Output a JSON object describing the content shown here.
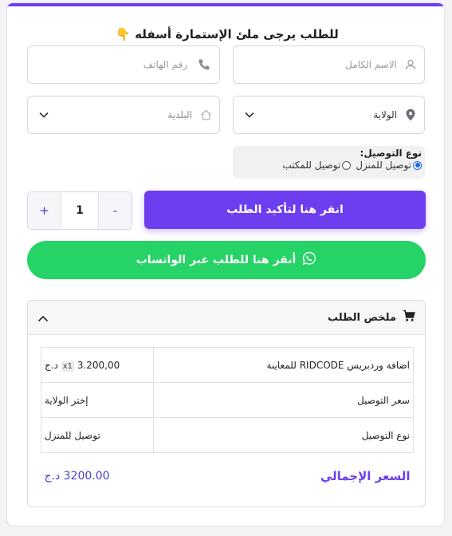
{
  "colors": {
    "accent": "#6c3ef0",
    "whatsapp": "#25d366"
  },
  "form": {
    "title": "للطلب يرجى ملئ الإستمارة أسفله",
    "title_emoji": "👇",
    "full_name_placeholder": "الاسم الكامل",
    "phone_placeholder": "رقم الهاتف",
    "state_select": "الولاية",
    "municipality_select": "البلدية",
    "delivery_type_label": "نوع التوصيل:",
    "delivery_options": [
      {
        "label": "توصيل للمنزل",
        "checked": true
      },
      {
        "label": "توصيل للمكتب",
        "checked": false
      }
    ],
    "quantity": "1",
    "minus_label": "-",
    "plus_label": "+",
    "confirm_button": "انقر هنا لتأكيد الطلب",
    "whatsapp_button": "أنقر هنا للطلب عبر الواتساب"
  },
  "summary": {
    "title": "ملخص الطلب",
    "rows": [
      {
        "label": "اضافة وردبريس RIDCODE للمعاينة",
        "qty": "x1",
        "value": "3.200,00 د.ج"
      },
      {
        "label": "سعر التوصيل",
        "value": "إختر الولاية"
      },
      {
        "label": "نوع التوصيل",
        "value": "توصيل للمنزل"
      }
    ],
    "total_label": "السعر الإجمالي",
    "total_value": "3200.00 د.ج"
  }
}
